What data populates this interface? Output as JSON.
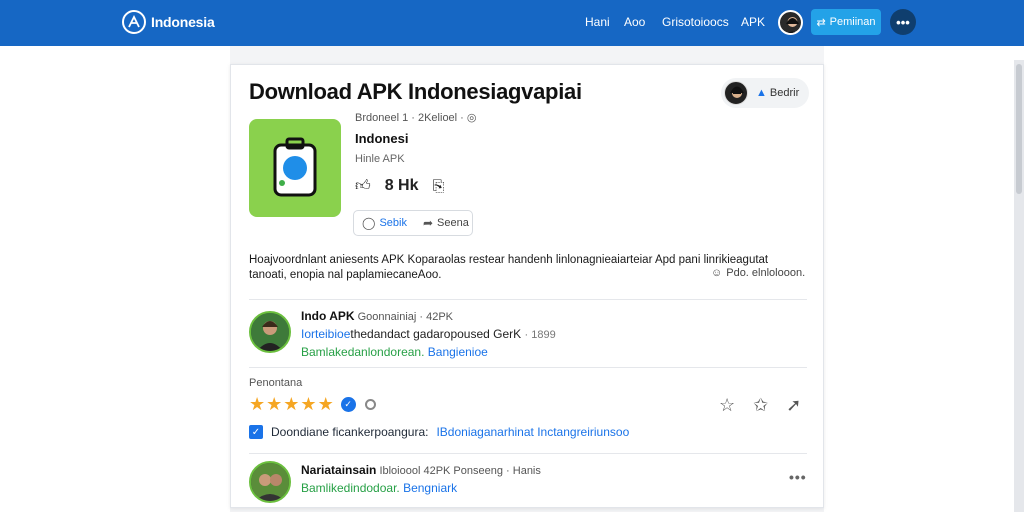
{
  "header": {
    "brand": "Indonesia",
    "nav": [
      "Hani",
      "Aoo",
      "Grisotoioocs",
      "APK"
    ],
    "cta_label": "Pemiinan",
    "more_label": "•••"
  },
  "card": {
    "title": "Download APK Indonesiagvapiai",
    "author_chip_label": "Bedrir",
    "meta_line": "Brdoneel 1 · 2Kelioel · ◎",
    "app_name": "Indonesi",
    "app_sub": "Hinle APK",
    "likes_count": "8 Hk",
    "share_actions": [
      "Sebik",
      "Seena"
    ],
    "description": "Hoajvoordnlant aniesents APK Koparaolas restear handenh linlonagnieaiarteiar Apd pani linrikieagutat tanoati, enopia nal paplamiecaneAoo.",
    "description_note": "Pdo. elnlolooon.",
    "comments": [
      {
        "name": "Indo APK",
        "meta": "Goonnainiaj · 42PK",
        "line1_blue": "Iorteibioe",
        "line1_dark": "thedandact gadaropoused GerK",
        "line1_gray": "· 1899",
        "line2_green": "Bamlakedanlondorean.",
        "line2_blue": "Bangienioe"
      },
      {
        "name": "Nariatainsain",
        "meta": "Ibloioool 42PK Ponseeng · Hanis",
        "line2_green": "Bamlikedindodoar.",
        "line2_blue": "Bengniark"
      }
    ],
    "section_label": "Penontana",
    "rating": 5,
    "check_dark": "Doondiane ficankerpoangura:",
    "check_blue": "IBdoniaganarhinat Inctangreiriunsoo"
  },
  "colors": {
    "brand_blue": "#1667c4",
    "accent": "#23a2e8",
    "star": "#f5a623",
    "app_icon": "#8ad14d"
  }
}
